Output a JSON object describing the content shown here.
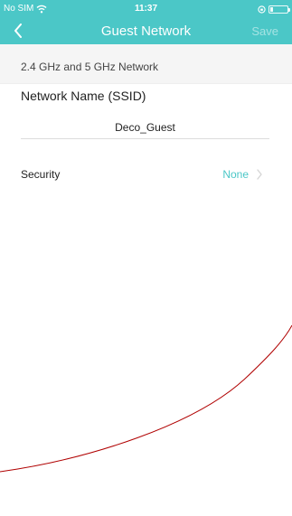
{
  "status_bar": {
    "carrier": "No SIM",
    "time": "11:37",
    "wifi_icon": "wifi-icon",
    "battery_icon": "battery-icon"
  },
  "nav": {
    "back_icon": "chevron-left-icon",
    "title": "Guest Network",
    "save_label": "Save"
  },
  "section": {
    "header": "2.4 GHz and 5 GHz Network"
  },
  "ssid": {
    "label": "Network Name (SSID)",
    "value": "Deco_Guest"
  },
  "security": {
    "label": "Security",
    "value": "None",
    "chevron_icon": "chevron-right-icon"
  },
  "colors": {
    "accent": "#4bc7c7",
    "annotation": "#b00000"
  }
}
